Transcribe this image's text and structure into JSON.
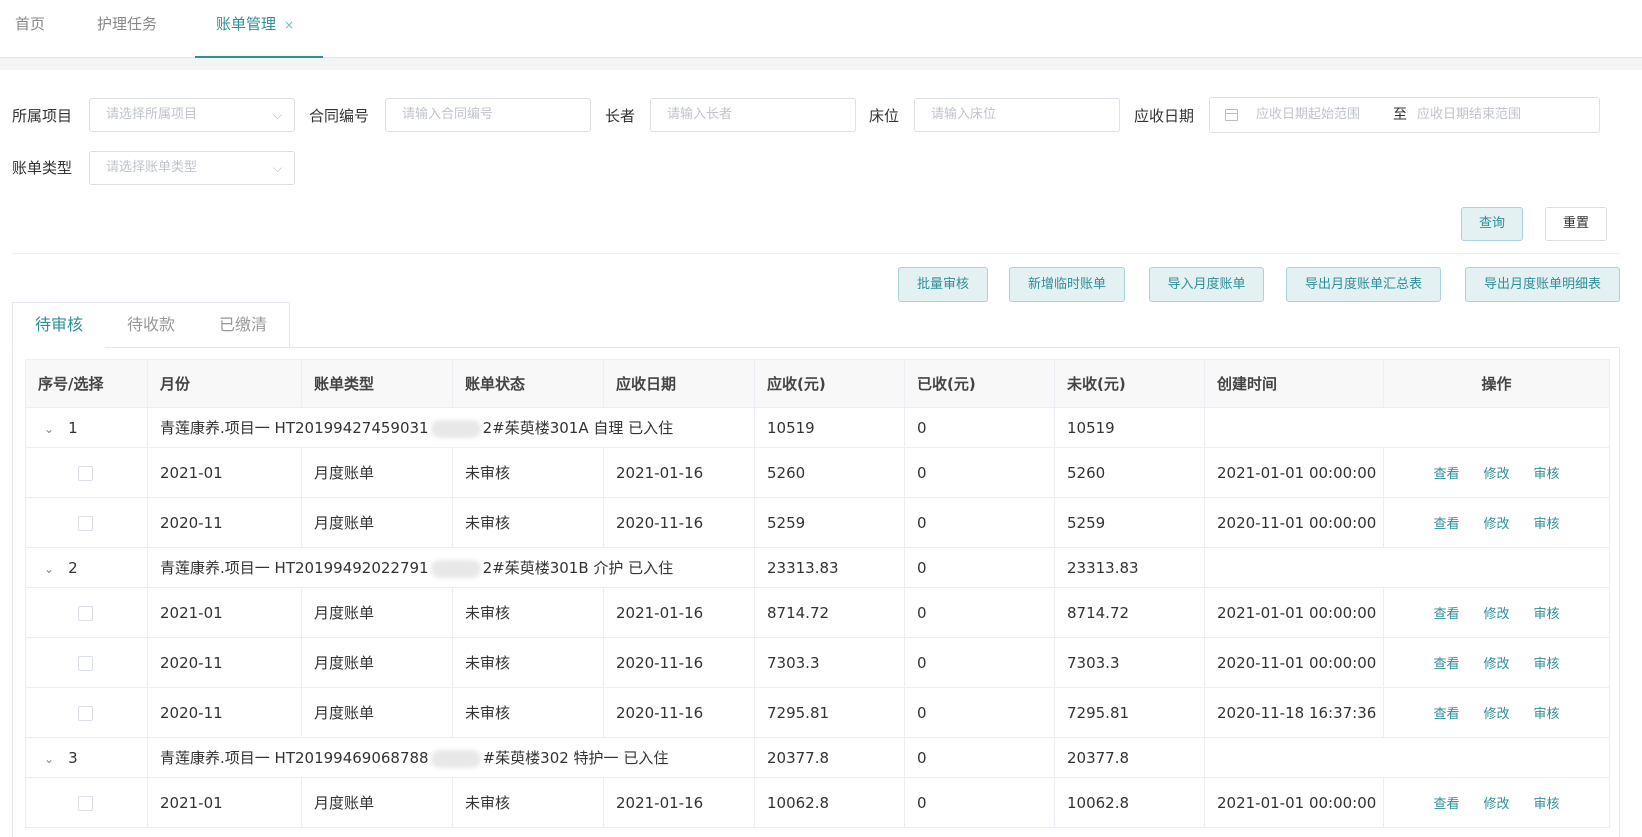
{
  "top_tabs": [
    {
      "label": "首页",
      "active": false
    },
    {
      "label": "护理任务",
      "active": false
    },
    {
      "label": "账单管理",
      "active": true,
      "closable": true,
      "close_glyph": "×"
    }
  ],
  "filters": {
    "project": {
      "label": "所属项目",
      "placeholder": "请选择所属项目"
    },
    "contract": {
      "label": "合同编号",
      "placeholder": "请输入合同编号"
    },
    "elder": {
      "label": "长者",
      "placeholder": "请输入长者"
    },
    "bed": {
      "label": "床位",
      "placeholder": "请输入床位"
    },
    "due_date": {
      "label": "应收日期",
      "start_placeholder": "应收日期起始范围",
      "separator": "至",
      "end_placeholder": "应收日期结束范围"
    },
    "bill_type": {
      "label": "账单类型",
      "placeholder": "请选择账单类型"
    }
  },
  "buttons": {
    "query": "查询",
    "reset": "重置",
    "batch_review": "批量审核",
    "add_temp_bill": "新增临时账单",
    "import_monthly": "导入月度账单",
    "export_summary": "导出月度账单汇总表",
    "export_detail": "导出月度账单明细表"
  },
  "sub_tabs": [
    {
      "label": "待审核",
      "active": true
    },
    {
      "label": "待收款",
      "active": false
    },
    {
      "label": "已缴清",
      "active": false
    }
  ],
  "table": {
    "headers": [
      "序号/选择",
      "月份",
      "账单类型",
      "账单状态",
      "应收日期",
      "应收(元)",
      "已收(元)",
      "未收(元)",
      "创建时间",
      "操作"
    ],
    "operations": [
      "查看",
      "修改",
      "审核"
    ],
    "groups": [
      {
        "index": "1",
        "summary_prefix": "青莲康养.项目一 HT20199427459031",
        "summary_suffix": "2#茱萸楼301A 自理 已入住",
        "receivable": "10519",
        "received": "0",
        "unreceived": "10519",
        "items": [
          {
            "month": "2021-01",
            "type": "月度账单",
            "status": "未审核",
            "due": "2021-01-16",
            "receivable": "5260",
            "received": "0",
            "unreceived": "5260",
            "created": "2021-01-01 00:00:00"
          },
          {
            "month": "2020-11",
            "type": "月度账单",
            "status": "未审核",
            "due": "2020-11-16",
            "receivable": "5259",
            "received": "0",
            "unreceived": "5259",
            "created": "2020-11-01 00:00:00"
          }
        ]
      },
      {
        "index": "2",
        "summary_prefix": "青莲康养.项目一 HT20199492022791",
        "summary_suffix": "2#茱萸楼301B 介护 已入住",
        "receivable": "23313.83",
        "received": "0",
        "unreceived": "23313.83",
        "items": [
          {
            "month": "2021-01",
            "type": "月度账单",
            "status": "未审核",
            "due": "2021-01-16",
            "receivable": "8714.72",
            "received": "0",
            "unreceived": "8714.72",
            "created": "2021-01-01 00:00:00"
          },
          {
            "month": "2020-11",
            "type": "月度账单",
            "status": "未审核",
            "due": "2020-11-16",
            "receivable": "7303.3",
            "received": "0",
            "unreceived": "7303.3",
            "created": "2020-11-01 00:00:00"
          },
          {
            "month": "2020-11",
            "type": "月度账单",
            "status": "未审核",
            "due": "2020-11-16",
            "receivable": "7295.81",
            "received": "0",
            "unreceived": "7295.81",
            "created": "2020-11-18 16:37:36"
          }
        ]
      },
      {
        "index": "3",
        "summary_prefix": "青莲康养.项目一 HT20199469068788",
        "summary_suffix": "#茱萸楼302 特护一 已入住",
        "receivable": "20377.8",
        "received": "0",
        "unreceived": "20377.8",
        "items": [
          {
            "month": "2021-01",
            "type": "月度账单",
            "status": "未审核",
            "due": "2021-01-16",
            "receivable": "10062.8",
            "received": "0",
            "unreceived": "10062.8",
            "created": "2021-01-01 00:00:00"
          }
        ]
      }
    ]
  }
}
